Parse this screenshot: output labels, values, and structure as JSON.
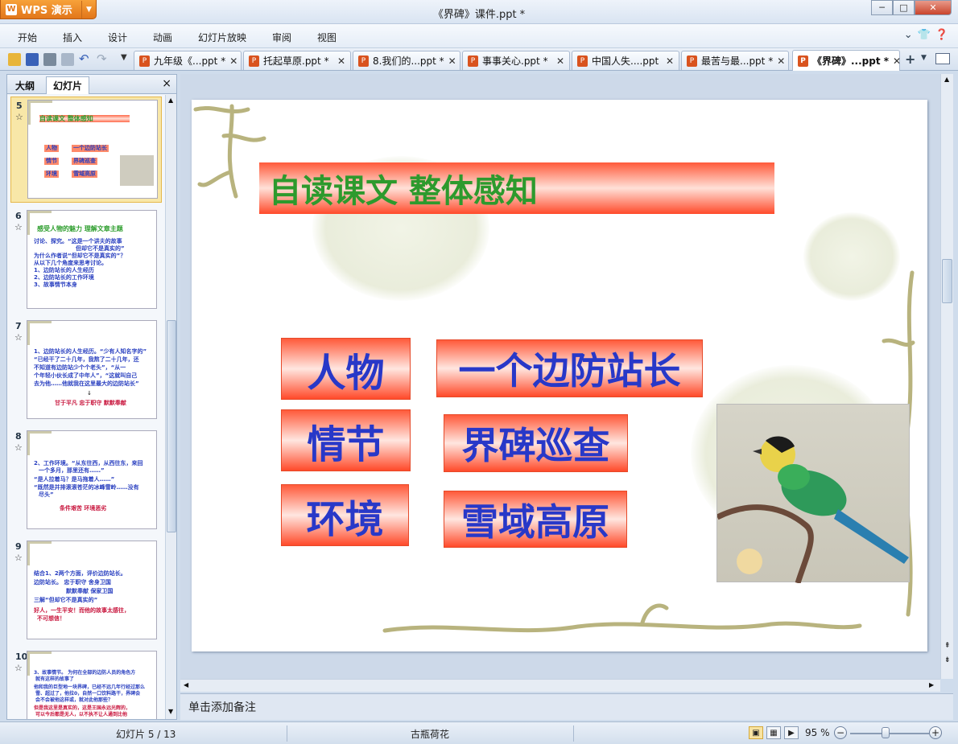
{
  "app": {
    "button_label": "WPS 演示",
    "window_title": "《界碑》课件.ppt *"
  },
  "menu": [
    "开始",
    "插入",
    "设计",
    "动画",
    "幻灯片放映",
    "审阅",
    "视图"
  ],
  "doc_tabs": [
    {
      "label": "九年级《...ppt *"
    },
    {
      "label": "托起草原.ppt *"
    },
    {
      "label": "8.我们的...ppt *"
    },
    {
      "label": "事事关心.ppt *"
    },
    {
      "label": "中国人失....ppt"
    },
    {
      "label": "最苦与最...ppt *"
    },
    {
      "label": "《界碑》...ppt *"
    }
  ],
  "left_panel": {
    "tab_outline": "大纲",
    "tab_slides": "幻灯片",
    "close": "×"
  },
  "thumbnails": [
    {
      "num": "5",
      "lines": [
        "自读课文 整体感知",
        "人物",
        "一个边防站长",
        "情节",
        "界碑巡查",
        "环境",
        "雪域高原"
      ]
    },
    {
      "num": "6",
      "lines": [
        "感受人物的魅力  理解文章主题",
        "讨论、探究。“这是一个讲夫的故事",
        "但却它不是真实的”",
        "为什么作者说“但却它不是真实的”？",
        "从以下几个角度来思考讨论。",
        "1、边防站长的人生经历",
        "2、边防站长的工作环境",
        "3、故事情节本身"
      ]
    },
    {
      "num": "7",
      "lines": [
        "1、边防站长的人生经历。“少有人知名字的”",
        "“已经干了二十几年，我熬了二十几年，还",
        "不知道有边防站少个个老头”，“从一",
        "个年轻小伙长成了中年人”，“这就叫自己",
        "去为他……他就我在这里最大的边防站长”",
        "甘于平凡  忠于职守  默默奉献"
      ]
    },
    {
      "num": "8",
      "lines": [
        "2、工作环境。“从东往西，从西往东，来回",
        "一个多月，那里还有……”",
        "“是人拉着马？是马拖着人……”",
        "“既然是并排滚滚苍茫的冰峰雪岭……没有",
        "尽头”",
        "条件艰苦  环境恶劣"
      ]
    },
    {
      "num": "9",
      "lines": [
        "结合1、2两个方面，评价边防站长。",
        "边防站长。  忠于职守    舍身卫国",
        "默默奉献    保家卫国",
        "三解“但却它不是真实的”",
        "好人，一生平安！而他的故事太感往，",
        "不可想信！"
      ]
    },
    {
      "num": "10",
      "lines": [
        "3、故事情节。  为何在全部的边防人员的角色方",
        "就有这样的故事了",
        "他和我的巨型地一块界碑，已经不远几年行经过那么",
        "雪、超过了，他拉0，自然一口饮料路干，界碑会",
        "会不会被他这样或，就对此他那些？",
        "但是我这里是真实的，这是王国永远光辉的，",
        "可以今后都是无人，以不执不让人通到比他",
        "……"
      ]
    }
  ],
  "slide": {
    "title": "自读课文 整体感知",
    "rows": [
      {
        "left": "人物",
        "right": "一个边防站长"
      },
      {
        "left": "情节",
        "right": "界碑巡查"
      },
      {
        "left": "环境",
        "right": "雪域高原"
      }
    ]
  },
  "notes_placeholder": "单击添加备注",
  "status": {
    "slide_counter": "幻灯片 5 / 13",
    "theme": "古瓶荷花",
    "zoom": "95 %"
  },
  "colors": {
    "accent_orange": "#e2761a",
    "title_green": "#2d9a2d",
    "box_text_blue": "#2838c8",
    "box_red": "#ff4a2a"
  }
}
